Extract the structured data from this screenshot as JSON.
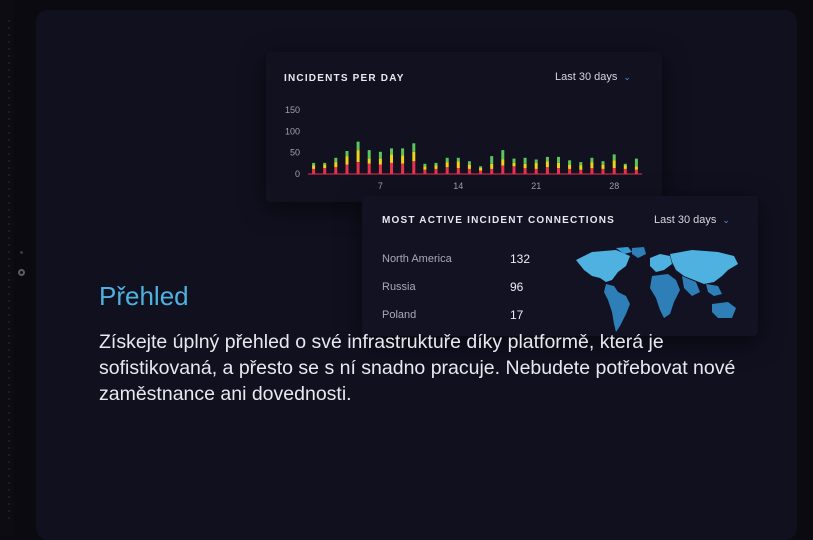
{
  "incidents_card": {
    "title": "INCIDENTS PER DAY",
    "range": "Last 30 days",
    "chevron_icon": "chevron-down-icon"
  },
  "chart_data": {
    "type": "bar",
    "title": "INCIDENTS PER DAY",
    "xlabel": "",
    "ylabel": "",
    "ylim": [
      0,
      150
    ],
    "y_ticks": [
      "150",
      "100",
      "50",
      "0"
    ],
    "x_ticks": [
      "7",
      "14",
      "21",
      "28"
    ],
    "categories": [
      1,
      2,
      3,
      4,
      5,
      6,
      7,
      8,
      9,
      10,
      11,
      12,
      13,
      14,
      15,
      16,
      17,
      18,
      19,
      20,
      21,
      22,
      23,
      24,
      25,
      26,
      27,
      28,
      29,
      30
    ],
    "series": [
      {
        "values": [
          12,
          14,
          16,
          22,
          28,
          24,
          22,
          26,
          24,
          30,
          10,
          12,
          16,
          14,
          12,
          8,
          12,
          20,
          18,
          14,
          12,
          16,
          14,
          12,
          10,
          14,
          12,
          14,
          12,
          10
        ]
      },
      {
        "values": [
          8,
          8,
          12,
          20,
          28,
          12,
          14,
          20,
          20,
          22,
          8,
          8,
          12,
          16,
          10,
          6,
          12,
          14,
          8,
          10,
          14,
          14,
          12,
          10,
          10,
          14,
          10,
          18,
          8,
          8
        ]
      },
      {
        "values": [
          6,
          4,
          10,
          12,
          20,
          20,
          16,
          14,
          16,
          20,
          6,
          6,
          10,
          8,
          8,
          4,
          18,
          22,
          10,
          14,
          8,
          10,
          14,
          10,
          8,
          10,
          8,
          14,
          4,
          18
        ]
      }
    ],
    "colors": {
      "bottom": "#e8314f",
      "middle": "#f0d21a",
      "top": "#5dc55c"
    }
  },
  "connections_card": {
    "title": "MOST ACTIVE INCIDENT CONNECTIONS",
    "range": "Last 30 days",
    "rows": [
      {
        "name": "North America",
        "value": "132"
      },
      {
        "name": "Russia",
        "value": "96"
      },
      {
        "name": "Poland",
        "value": "17"
      }
    ],
    "map_icon": "world-map-icon"
  },
  "section": {
    "heading": "Přehled",
    "description": "Získejte úplný přehled o své infrastruktuře díky platformě, která je sofistikovaná, a přesto se s ní snadno pracuje. Nebudete potřebovat nové zaměstnance ani dovednosti."
  },
  "colors": {
    "accent": "#4fb1e0",
    "map_fill": "#2e7fb8",
    "map_highlight": "#4fb1e0"
  }
}
